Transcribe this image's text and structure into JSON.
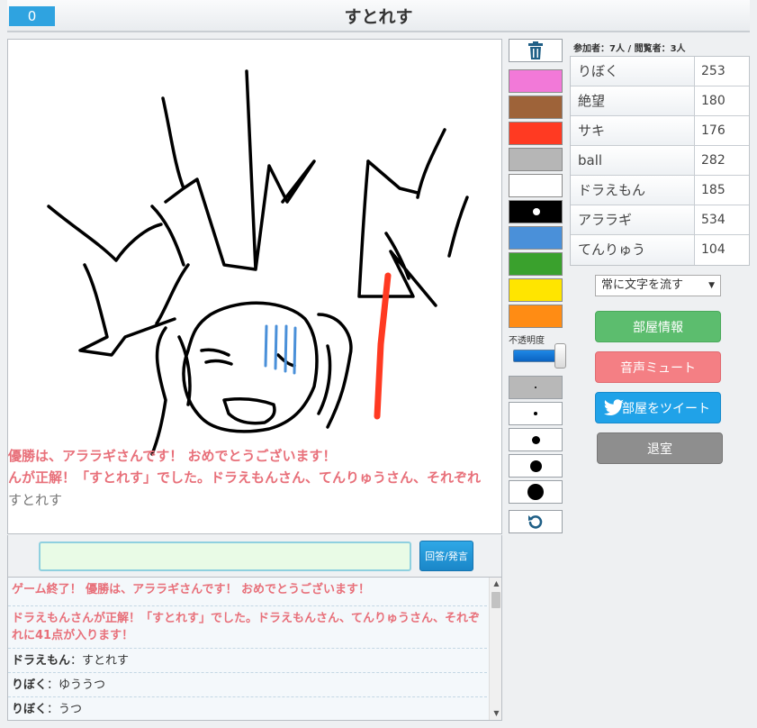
{
  "header": {
    "timer": "0",
    "title": "すとれす"
  },
  "canvas_overlay": {
    "line1": "優勝は、アララギさんです！ おめでとうございます！",
    "line2": "んが正解！「すとれす」でした。ドラえもんさん、てんりゅうさん、それぞれ",
    "line3": "すとれす"
  },
  "palette": {
    "colors": [
      "#f279d8",
      "#9e6339",
      "#ff3a22",
      "#b6b6b6",
      "#ffffff",
      "#000000",
      "#4a90d9",
      "#3aa12d",
      "#ffe500",
      "#ff8c14"
    ],
    "opacity_label": "不透明度",
    "opacity_value": 1.0
  },
  "answer": {
    "input_value": "",
    "button_label": "回答/発言"
  },
  "log": {
    "sys1": "ゲーム終了！ 優勝は、アララギさんです！ おめでとうございます！",
    "sys2": "ドラえもんさんが正解！「すとれす」でした。ドラえもんさん、てんりゅうさん、それぞれに41点が入ります！",
    "chat": [
      {
        "name": "ドラえもん",
        "sep": "：",
        "text": "すとれす"
      },
      {
        "name": "りぼく",
        "sep": "：",
        "text": "ゆううつ"
      },
      {
        "name": "りぼく",
        "sep": "：",
        "text": "うつ"
      }
    ]
  },
  "room": {
    "counts": "参加者：7人 / 閲覧者：3人"
  },
  "players": [
    {
      "name": "りぼく",
      "score": "253"
    },
    {
      "name": "絶望",
      "score": "180"
    },
    {
      "name": "サキ",
      "score": "176"
    },
    {
      "name": "ball",
      "score": "282"
    },
    {
      "name": "ドラえもん",
      "score": "185"
    },
    {
      "name": "アララギ",
      "score": "534"
    },
    {
      "name": "てんりゅう",
      "score": "104"
    }
  ],
  "controls": {
    "text_mode": "常に文字を流す",
    "room_info": "部屋情報",
    "mute": "音声ミュート",
    "tweet": "部屋をツイート",
    "exit": "退室"
  },
  "colors": {
    "accent_blue": "#2fa3e0",
    "system_msg": "#e8707a",
    "green": "#5cbd6e",
    "pink": "#f47f84",
    "gray": "#8e8e8e"
  }
}
